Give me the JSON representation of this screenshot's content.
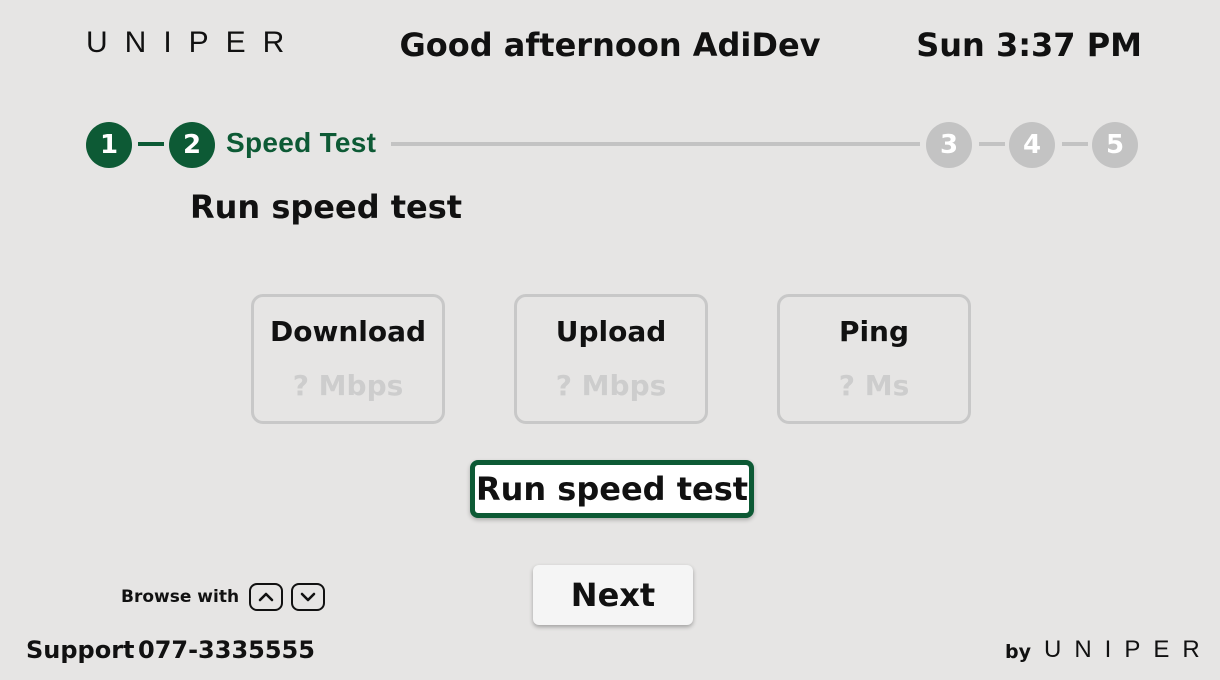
{
  "header": {
    "logo": "UNIPER",
    "greeting": "Good afternoon AdiDev",
    "clock": "Sun 3:37 PM"
  },
  "stepper": {
    "steps": [
      "1",
      "2",
      "3",
      "4",
      "5"
    ],
    "current_label": "Speed Test",
    "current_step": 2
  },
  "section": {
    "title": "Run speed test"
  },
  "metrics": [
    {
      "label": "Download",
      "value": "? Mbps"
    },
    {
      "label": "Upload",
      "value": "? Mbps"
    },
    {
      "label": "Ping",
      "value": "? Ms"
    }
  ],
  "actions": {
    "run_label": "Run speed test",
    "next_label": "Next"
  },
  "footer": {
    "browse_text": "Browse with",
    "up_key_icon": "chevron-up-icon",
    "down_key_icon": "chevron-down-icon",
    "support_label": "Support",
    "support_phone": "077-3335555",
    "by_text": "by",
    "by_logo": "UNIPER"
  },
  "colors": {
    "accent": "#0d5a35",
    "inactive": "#c3c3c3",
    "background": "#e6e5e4"
  }
}
